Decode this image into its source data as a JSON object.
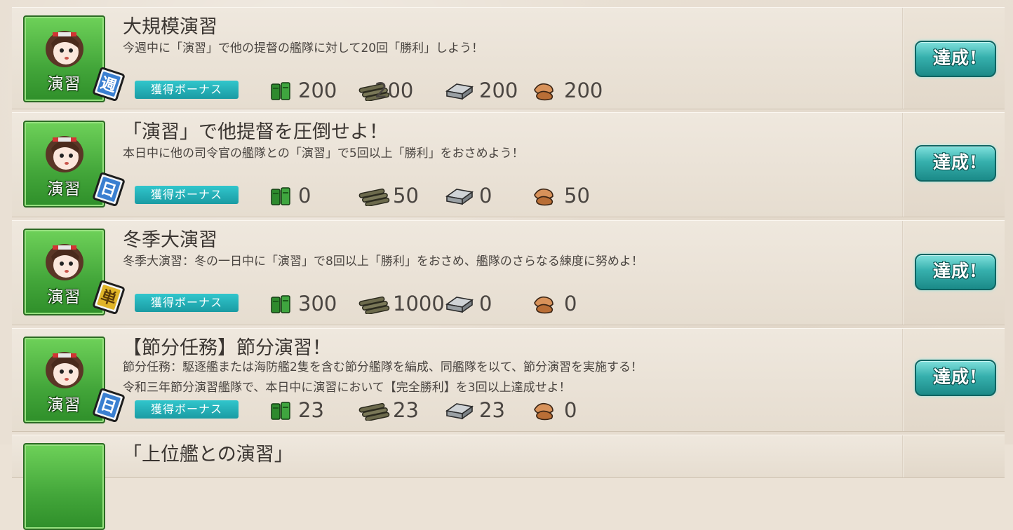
{
  "bonus_label": "獲得ボーナス",
  "complete_label": "達成!",
  "category_label": "演習",
  "colors": {
    "badge_green": "#43a63a",
    "bonus_teal": "#1a9ba3",
    "complete_teal": "#36b0ad",
    "freq_weekly": "#3a7fd0",
    "freq_daily": "#3a7fd0",
    "freq_once": "#e0b428"
  },
  "icons": [
    "fuel-icon",
    "ammo-icon",
    "steel-icon",
    "bauxite-icon"
  ],
  "quests": [
    {
      "title": "大規模演習",
      "desc1": "今週中に「演習」で他の提督の艦隊に対して20回「勝利」しよう！",
      "desc2": "",
      "frequency": "週",
      "fuel": "200",
      "ammo": "200",
      "steel": "200",
      "bauxite": "200"
    },
    {
      "title": "「演習」で他提督を圧倒せよ！",
      "desc1": "本日中に他の司令官の艦隊との「演習」で5回以上「勝利」をおさめよう！",
      "desc2": "",
      "frequency": "日",
      "fuel": "0",
      "ammo": "50",
      "steel": "0",
      "bauxite": "50"
    },
    {
      "title": "冬季大演習",
      "desc1": "冬季大演習：冬の一日中に「演習」で8回以上「勝利」をおさめ、艦隊のさらなる練度に努めよ！",
      "desc2": "",
      "frequency": "単",
      "fuel": "300",
      "ammo": "1000",
      "steel": "0",
      "bauxite": "0"
    },
    {
      "title": "【節分任務】節分演習！",
      "desc1": "節分任務：駆逐艦または海防艦2隻を含む節分艦隊を編成、同艦隊を以て、節分演習を実施する！",
      "desc2": "令和三年節分演習艦隊で、本日中に演習において【完全勝利】を3回以上達成せよ！",
      "frequency": "日",
      "fuel": "23",
      "ammo": "23",
      "steel": "23",
      "bauxite": "0"
    },
    {
      "title": "「上位艦との演習」",
      "desc1": "",
      "desc2": "",
      "frequency": "",
      "fuel": "",
      "ammo": "",
      "steel": "",
      "bauxite": ""
    }
  ]
}
